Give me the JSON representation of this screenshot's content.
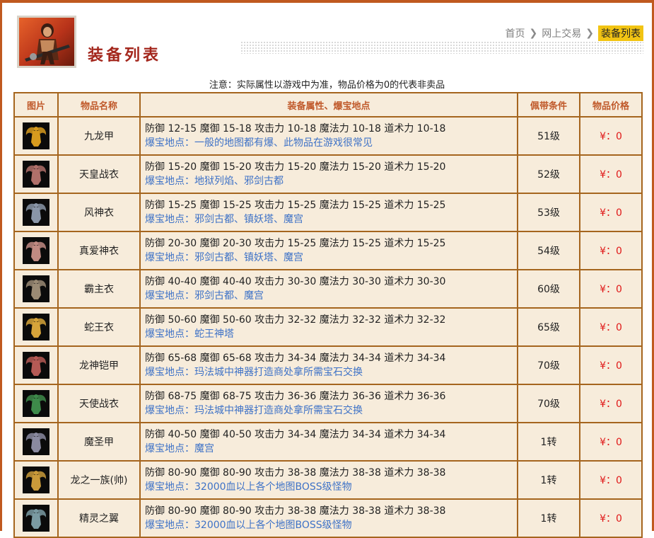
{
  "header": {
    "title": "装备列表",
    "breadcrumb": [
      "首页",
      "网上交易",
      "装备列表"
    ]
  },
  "notice": "注意：实际属性以游戏中为准，物品价格为0的代表非卖品",
  "table": {
    "columns": [
      "图片",
      "物品名称",
      "装备属性、爆宝地点",
      "佩带条件",
      "物品价格"
    ],
    "rows": [
      {
        "name": "九龙甲",
        "attrs": "防御 12-15 魔御 15-18 攻击力 10-18 魔法力 10-18 道术力 10-18",
        "drop": "爆宝地点：一般的地图都有爆、此物品在游戏很常见",
        "req": "51级",
        "price": "¥：0",
        "icon_color": "#d79b1e"
      },
      {
        "name": "天皇战衣",
        "attrs": "防御 15-20 魔御 15-20 攻击力 15-20 魔法力 15-20 道术力 15-20",
        "drop": "爆宝地点：地狱列焰、邪剑古都",
        "req": "52级",
        "price": "¥：0",
        "icon_color": "#b0706a"
      },
      {
        "name": "风神衣",
        "attrs": "防御 15-25 魔御 15-25 攻击力 15-25 魔法力 15-25 道术力 15-25",
        "drop": "爆宝地点：邪剑古都、镇妖塔、魔宫",
        "req": "53级",
        "price": "¥：0",
        "icon_color": "#8a96a8"
      },
      {
        "name": "真爱神衣",
        "attrs": "防御 20-30 魔御 20-30 攻击力 15-25 魔法力 15-25 道术力 15-25",
        "drop": "爆宝地点：邪剑古都、镇妖塔、魔宫",
        "req": "54级",
        "price": "¥：0",
        "icon_color": "#c08a82"
      },
      {
        "name": "霸主衣",
        "attrs": "防御 40-40 魔御 40-40 攻击力 30-30 魔法力 30-30 道术力 30-30",
        "drop": "爆宝地点：邪剑古都、魔宫",
        "req": "60级",
        "price": "¥：0",
        "icon_color": "#9a8a74"
      },
      {
        "name": "蛇王衣",
        "attrs": "防御 50-60 魔御 50-60 攻击力 32-32 魔法力 32-32 道术力 32-32",
        "drop": "爆宝地点：蛇王神塔",
        "req": "65级",
        "price": "¥：0",
        "icon_color": "#d6a43a"
      },
      {
        "name": "龙神铠甲",
        "attrs": "防御 65-68 魔御 65-68 攻击力 34-34 魔法力 34-34 道术力 34-34",
        "drop": "爆宝地点：玛法城中神器打造商处拿所需宝石交换",
        "req": "70级",
        "price": "¥：0",
        "icon_color": "#b55a55"
      },
      {
        "name": "天使战衣",
        "attrs": "防御 68-75 魔御 68-75 攻击力 36-36 魔法力 36-36 道术力 36-36",
        "drop": "爆宝地点：玛法城中神器打造商处拿所需宝石交换",
        "req": "70级",
        "price": "¥：0",
        "icon_color": "#3e8a4a"
      },
      {
        "name": "魔圣甲",
        "attrs": "防御 40-50 魔御 40-50 攻击力 34-34 魔法力 34-34 道术力 34-34",
        "drop": "爆宝地点：魔宫",
        "req": "1转",
        "price": "¥：0",
        "icon_color": "#8a8aa0"
      },
      {
        "name": "龙之一族(帅)",
        "attrs": "防御 80-90 魔御 80-90 攻击力 38-38 魔法力 38-38 道术力 38-38",
        "drop": "爆宝地点：32000血以上各个地图BOSS级怪物",
        "req": "1转",
        "price": "¥：0",
        "icon_color": "#c99a3a"
      },
      {
        "name": "精灵之翼",
        "attrs": "防御 80-90 魔御 80-90 攻击力 38-38 魔法力 38-38 道术力 38-38",
        "drop": "爆宝地点：32000血以上各个地图BOSS级怪物",
        "req": "1转",
        "price": "¥：0",
        "icon_color": "#7a9aa2"
      }
    ]
  }
}
